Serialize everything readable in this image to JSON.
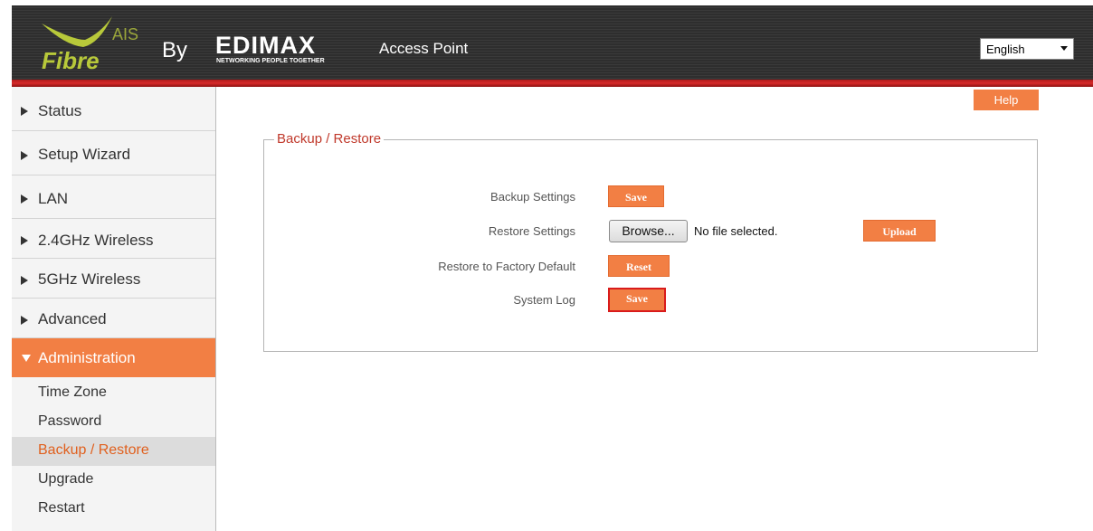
{
  "header": {
    "brand": {
      "top": "AIS",
      "bottom": "Fibre"
    },
    "by_label": "By",
    "edimax": {
      "name": "EDIMAX",
      "tagline": "NETWORKING PEOPLE TOGETHER"
    },
    "product": "Access Point",
    "language": {
      "selected": "English"
    }
  },
  "sidebar": {
    "items": [
      {
        "label": "Status"
      },
      {
        "label": "Setup Wizard"
      },
      {
        "label": "LAN"
      },
      {
        "label": "2.4GHz Wireless"
      },
      {
        "label": "5GHz Wireless"
      },
      {
        "label": "Advanced"
      },
      {
        "label": "Administration",
        "expanded": true
      }
    ],
    "sub_items": [
      {
        "label": "Time Zone"
      },
      {
        "label": "Password"
      },
      {
        "label": "Backup / Restore",
        "selected": true
      },
      {
        "label": "Upgrade"
      },
      {
        "label": "Restart"
      }
    ]
  },
  "content": {
    "help_label": "Help",
    "section_title": "Backup / Restore",
    "rows": {
      "backup": {
        "label": "Backup Settings",
        "button": "Save"
      },
      "restore": {
        "label": "Restore Settings",
        "browse": "Browse...",
        "file_status": "No file selected.",
        "button": "Upload"
      },
      "factory": {
        "label": "Restore to Factory Default",
        "button": "Reset"
      },
      "syslog": {
        "label": "System Log",
        "button": "Save"
      }
    }
  },
  "colors": {
    "accent": "#f27f44",
    "legend": "#c0392b",
    "header_bg": "#2e2e2e",
    "highlight_border": "#d91b1b"
  }
}
